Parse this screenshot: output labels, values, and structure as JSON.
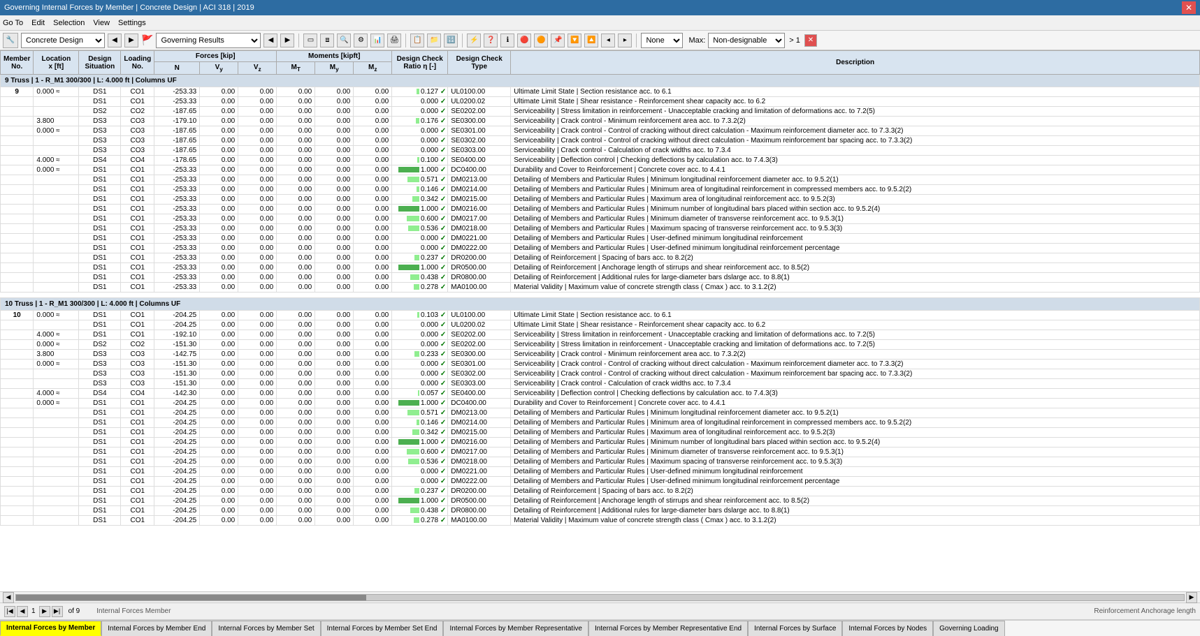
{
  "titleBar": {
    "title": "Governing Internal Forces by Member | Concrete Design | ACI 318 | 2019",
    "closeBtn": "✕"
  },
  "menuBar": {
    "items": [
      "Go To",
      "Edit",
      "Selection",
      "View",
      "Settings"
    ]
  },
  "toolbar": {
    "designSelect": "Concrete Design",
    "resultSelect": "Governing Results",
    "noneLabel": "None",
    "maxLabel": "Max:",
    "nonDesignableLabel": "Non-designable",
    "gt1Label": "> 1"
  },
  "tableHeaders": {
    "member": "Member\nNo.",
    "location": "Location\nx [ft]",
    "design": "Design\nSituation",
    "loading": "Loading\nNo.",
    "forcesLabel": "Forces [kip]",
    "N": "N",
    "Vy": "Vy",
    "Vz": "Vz",
    "momentsLabel": "Moments [kipft]",
    "MT": "MT",
    "My": "My",
    "Mz": "Mz",
    "ratioLabel": "Design Check\nRatio η [-]",
    "typeLabel": "Design Check\nType",
    "description": "Description"
  },
  "group1": {
    "header": "9    Truss | 1 - R_M1 300/300 | L: 4.000 ft | Columns UF",
    "rows": [
      {
        "loc": "0.000 ≈",
        "ds": "DS1",
        "load": "CO1",
        "N": "-253.33",
        "Vy": "0.00",
        "Vz": "0.00",
        "MT": "0.00",
        "My": "0.00",
        "Mz": "0.00",
        "ratio": "0.127",
        "check": "✓",
        "type": "UL0100.00",
        "desc": "Ultimate Limit State | Section resistance acc. to 6.1"
      },
      {
        "loc": "",
        "ds": "DS1",
        "load": "CO1",
        "N": "-253.33",
        "Vy": "0.00",
        "Vz": "0.00",
        "MT": "0.00",
        "My": "0.00",
        "Mz": "0.00",
        "ratio": "0.000",
        "check": "✓",
        "type": "UL0200.02",
        "desc": "Ultimate Limit State | Shear resistance - Reinforcement shear capacity acc. to 6.2"
      },
      {
        "loc": "",
        "ds": "DS2",
        "load": "CO2",
        "N": "-187.65",
        "Vy": "0.00",
        "Vz": "0.00",
        "MT": "0.00",
        "My": "0.00",
        "Mz": "0.00",
        "ratio": "0.000",
        "check": "✓",
        "type": "SE0202.00",
        "desc": "Serviceability | Stress limitation in reinforcement - Unacceptable cracking and limitation of deformations acc. to 7.2(5)"
      },
      {
        "loc": "3.800",
        "ds": "DS3",
        "load": "CO3",
        "N": "-179.10",
        "Vy": "0.00",
        "Vz": "0.00",
        "MT": "0.00",
        "My": "0.00",
        "Mz": "0.00",
        "ratio": "0.176",
        "check": "✓",
        "type": "SE0300.00",
        "desc": "Serviceability | Crack control - Minimum reinforcement area acc. to 7.3.2(2)"
      },
      {
        "loc": "0.000 ≈",
        "ds": "DS3",
        "load": "CO3",
        "N": "-187.65",
        "Vy": "0.00",
        "Vz": "0.00",
        "MT": "0.00",
        "My": "0.00",
        "Mz": "0.00",
        "ratio": "0.000",
        "check": "✓",
        "type": "SE0301.00",
        "desc": "Serviceability | Crack control - Control of cracking without direct calculation - Maximum reinforcement diameter acc. to 7.3.3(2)"
      },
      {
        "loc": "",
        "ds": "DS3",
        "load": "CO3",
        "N": "-187.65",
        "Vy": "0.00",
        "Vz": "0.00",
        "MT": "0.00",
        "My": "0.00",
        "Mz": "0.00",
        "ratio": "0.000",
        "check": "✓",
        "type": "SE0302.00",
        "desc": "Serviceability | Crack control - Control of cracking without direct calculation - Maximum reinforcement bar spacing acc. to 7.3.3(2)"
      },
      {
        "loc": "",
        "ds": "DS3",
        "load": "CO3",
        "N": "-187.65",
        "Vy": "0.00",
        "Vz": "0.00",
        "MT": "0.00",
        "My": "0.00",
        "Mz": "0.00",
        "ratio": "0.000",
        "check": "✓",
        "type": "SE0303.00",
        "desc": "Serviceability | Crack control - Calculation of crack widths acc. to 7.3.4"
      },
      {
        "loc": "4.000 ≈",
        "ds": "DS4",
        "load": "CO4",
        "N": "-178.65",
        "Vy": "0.00",
        "Vz": "0.00",
        "MT": "0.00",
        "My": "0.00",
        "Mz": "0.00",
        "ratio": "0.100",
        "check": "✓",
        "type": "SE0400.00",
        "desc": "Serviceability | Deflection control | Checking deflections by calculation acc. to 7.4.3(3)"
      },
      {
        "loc": "0.000 ≈",
        "ds": "DS1",
        "load": "CO1",
        "N": "-253.33",
        "Vy": "0.00",
        "Vz": "0.00",
        "MT": "0.00",
        "My": "0.00",
        "Mz": "0.00",
        "ratio": "1.000",
        "check": "✓",
        "type": "DC0400.00",
        "desc": "Durability and Cover to Reinforcement | Concrete cover acc. to 4.4.1"
      },
      {
        "loc": "",
        "ds": "DS1",
        "load": "CO1",
        "N": "-253.33",
        "Vy": "0.00",
        "Vz": "0.00",
        "MT": "0.00",
        "My": "0.00",
        "Mz": "0.00",
        "ratio": "0.571",
        "check": "✓",
        "type": "DM0213.00",
        "desc": "Detailing of Members and Particular Rules | Minimum longitudinal reinforcement diameter acc. to 9.5.2(1)"
      },
      {
        "loc": "",
        "ds": "DS1",
        "load": "CO1",
        "N": "-253.33",
        "Vy": "0.00",
        "Vz": "0.00",
        "MT": "0.00",
        "My": "0.00",
        "Mz": "0.00",
        "ratio": "0.146",
        "check": "✓",
        "type": "DM0214.00",
        "desc": "Detailing of Members and Particular Rules | Minimum area of longitudinal reinforcement in compressed members acc. to 9.5.2(2)"
      },
      {
        "loc": "",
        "ds": "DS1",
        "load": "CO1",
        "N": "-253.33",
        "Vy": "0.00",
        "Vz": "0.00",
        "MT": "0.00",
        "My": "0.00",
        "Mz": "0.00",
        "ratio": "0.342",
        "check": "✓",
        "type": "DM0215.00",
        "desc": "Detailing of Members and Particular Rules | Maximum area of longitudinal reinforcement acc. to 9.5.2(3)"
      },
      {
        "loc": "",
        "ds": "DS1",
        "load": "CO1",
        "N": "-253.33",
        "Vy": "0.00",
        "Vz": "0.00",
        "MT": "0.00",
        "My": "0.00",
        "Mz": "0.00",
        "ratio": "1.000",
        "check": "✓",
        "type": "DM0216.00",
        "desc": "Detailing of Members and Particular Rules | Minimum number of longitudinal bars placed within section acc. to 9.5.2(4)"
      },
      {
        "loc": "",
        "ds": "DS1",
        "load": "CO1",
        "N": "-253.33",
        "Vy": "0.00",
        "Vz": "0.00",
        "MT": "0.00",
        "My": "0.00",
        "Mz": "0.00",
        "ratio": "0.600",
        "check": "✓",
        "type": "DM0217.00",
        "desc": "Detailing of Members and Particular Rules | Minimum diameter of transverse reinforcement acc. to 9.5.3(1)"
      },
      {
        "loc": "",
        "ds": "DS1",
        "load": "CO1",
        "N": "-253.33",
        "Vy": "0.00",
        "Vz": "0.00",
        "MT": "0.00",
        "My": "0.00",
        "Mz": "0.00",
        "ratio": "0.536",
        "check": "✓",
        "type": "DM0218.00",
        "desc": "Detailing of Members and Particular Rules | Maximum spacing of transverse reinforcement acc. to 9.5.3(3)"
      },
      {
        "loc": "",
        "ds": "DS1",
        "load": "CO1",
        "N": "-253.33",
        "Vy": "0.00",
        "Vz": "0.00",
        "MT": "0.00",
        "My": "0.00",
        "Mz": "0.00",
        "ratio": "0.000",
        "check": "✓",
        "type": "DM0221.00",
        "desc": "Detailing of Members and Particular Rules | User-defined minimum longitudinal reinforcement"
      },
      {
        "loc": "",
        "ds": "DS1",
        "load": "CO1",
        "N": "-253.33",
        "Vy": "0.00",
        "Vz": "0.00",
        "MT": "0.00",
        "My": "0.00",
        "Mz": "0.00",
        "ratio": "0.000",
        "check": "✓",
        "type": "DM0222.00",
        "desc": "Detailing of Members and Particular Rules | User-defined minimum longitudinal reinforcement percentage"
      },
      {
        "loc": "",
        "ds": "DS1",
        "load": "CO1",
        "N": "-253.33",
        "Vy": "0.00",
        "Vz": "0.00",
        "MT": "0.00",
        "My": "0.00",
        "Mz": "0.00",
        "ratio": "0.237",
        "check": "✓",
        "type": "DR0200.00",
        "desc": "Detailing of Reinforcement | Spacing of bars acc. to 8.2(2)"
      },
      {
        "loc": "",
        "ds": "DS1",
        "load": "CO1",
        "N": "-253.33",
        "Vy": "0.00",
        "Vz": "0.00",
        "MT": "0.00",
        "My": "0.00",
        "Mz": "0.00",
        "ratio": "1.000",
        "check": "✓",
        "type": "DR0500.00",
        "desc": "Detailing of Reinforcement | Anchorage length of stirrups and shear reinforcement acc. to 8.5(2)"
      },
      {
        "loc": "",
        "ds": "DS1",
        "load": "CO1",
        "N": "-253.33",
        "Vy": "0.00",
        "Vz": "0.00",
        "MT": "0.00",
        "My": "0.00",
        "Mz": "0.00",
        "ratio": "0.438",
        "check": "✓",
        "type": "DR0800.00",
        "desc": "Detailing of Reinforcement | Additional rules for large-diameter bars dslarge acc. to 8.8(1)"
      },
      {
        "loc": "",
        "ds": "DS1",
        "load": "CO1",
        "N": "-253.33",
        "Vy": "0.00",
        "Vz": "0.00",
        "MT": "0.00",
        "My": "0.00",
        "Mz": "0.00",
        "ratio": "0.278",
        "check": "✓",
        "type": "MA0100.00",
        "desc": "Material Validity | Maximum value of concrete strength class ( Cmax ) acc. to 3.1.2(2)"
      }
    ]
  },
  "group2": {
    "header": "10    Truss | 1 - R_M1 300/300 | L: 4.000 ft | Columns UF",
    "rows": [
      {
        "loc": "0.000 ≈",
        "ds": "DS1",
        "load": "CO1",
        "N": "-204.25",
        "Vy": "0.00",
        "Vz": "0.00",
        "MT": "0.00",
        "My": "0.00",
        "Mz": "0.00",
        "ratio": "0.103",
        "check": "✓",
        "type": "UL0100.00",
        "desc": "Ultimate Limit State | Section resistance acc. to 6.1"
      },
      {
        "loc": "",
        "ds": "DS1",
        "load": "CO1",
        "N": "-204.25",
        "Vy": "0.00",
        "Vz": "0.00",
        "MT": "0.00",
        "My": "0.00",
        "Mz": "0.00",
        "ratio": "0.000",
        "check": "✓",
        "type": "UL0200.02",
        "desc": "Ultimate Limit State | Shear resistance - Reinforcement shear capacity acc. to 6.2"
      },
      {
        "loc": "4.000 ≈",
        "ds": "DS1",
        "load": "CO1",
        "N": "-192.10",
        "Vy": "0.00",
        "Vz": "0.00",
        "MT": "0.00",
        "My": "0.00",
        "Mz": "0.00",
        "ratio": "0.000",
        "check": "✓",
        "type": "SE0202.00",
        "desc": "Serviceability | Stress limitation in reinforcement - Unacceptable cracking and limitation of deformations acc. to 7.2(5)"
      },
      {
        "loc": "0.000 ≈",
        "ds": "DS2",
        "load": "CO2",
        "N": "-151.30",
        "Vy": "0.00",
        "Vz": "0.00",
        "MT": "0.00",
        "My": "0.00",
        "Mz": "0.00",
        "ratio": "0.000",
        "check": "✓",
        "type": "SE0202.00",
        "desc": "Serviceability | Stress limitation in reinforcement - Unacceptable cracking and limitation of deformations acc. to 7.2(5)"
      },
      {
        "loc": "3.800",
        "ds": "DS3",
        "load": "CO3",
        "N": "-142.75",
        "Vy": "0.00",
        "Vz": "0.00",
        "MT": "0.00",
        "My": "0.00",
        "Mz": "0.00",
        "ratio": "0.233",
        "check": "✓",
        "type": "SE0300.00",
        "desc": "Serviceability | Crack control - Minimum reinforcement area acc. to 7.3.2(2)"
      },
      {
        "loc": "0.000 ≈",
        "ds": "DS3",
        "load": "CO3",
        "N": "-151.30",
        "Vy": "0.00",
        "Vz": "0.00",
        "MT": "0.00",
        "My": "0.00",
        "Mz": "0.00",
        "ratio": "0.000",
        "check": "✓",
        "type": "SE0301.00",
        "desc": "Serviceability | Crack control - Control of cracking without direct calculation - Maximum reinforcement diameter acc. to 7.3.3(2)"
      },
      {
        "loc": "",
        "ds": "DS3",
        "load": "CO3",
        "N": "-151.30",
        "Vy": "0.00",
        "Vz": "0.00",
        "MT": "0.00",
        "My": "0.00",
        "Mz": "0.00",
        "ratio": "0.000",
        "check": "✓",
        "type": "SE0302.00",
        "desc": "Serviceability | Crack control - Control of cracking without direct calculation - Maximum reinforcement bar spacing acc. to 7.3.3(2)"
      },
      {
        "loc": "",
        "ds": "DS3",
        "load": "CO3",
        "N": "-151.30",
        "Vy": "0.00",
        "Vz": "0.00",
        "MT": "0.00",
        "My": "0.00",
        "Mz": "0.00",
        "ratio": "0.000",
        "check": "✓",
        "type": "SE0303.00",
        "desc": "Serviceability | Crack control - Calculation of crack widths acc. to 7.3.4"
      },
      {
        "loc": "4.000 ≈",
        "ds": "DS4",
        "load": "CO4",
        "N": "-142.30",
        "Vy": "0.00",
        "Vz": "0.00",
        "MT": "0.00",
        "My": "0.00",
        "Mz": "0.00",
        "ratio": "0.057",
        "check": "✓",
        "type": "SE0400.00",
        "desc": "Serviceability | Deflection control | Checking deflections by calculation acc. to 7.4.3(3)"
      },
      {
        "loc": "0.000 ≈",
        "ds": "DS1",
        "load": "CO1",
        "N": "-204.25",
        "Vy": "0.00",
        "Vz": "0.00",
        "MT": "0.00",
        "My": "0.00",
        "Mz": "0.00",
        "ratio": "1.000",
        "check": "✓",
        "type": "DC0400.00",
        "desc": "Durability and Cover to Reinforcement | Concrete cover acc. to 4.4.1"
      },
      {
        "loc": "",
        "ds": "DS1",
        "load": "CO1",
        "N": "-204.25",
        "Vy": "0.00",
        "Vz": "0.00",
        "MT": "0.00",
        "My": "0.00",
        "Mz": "0.00",
        "ratio": "0.571",
        "check": "✓",
        "type": "DM0213.00",
        "desc": "Detailing of Members and Particular Rules | Minimum longitudinal reinforcement diameter acc. to 9.5.2(1)"
      },
      {
        "loc": "",
        "ds": "DS1",
        "load": "CO1",
        "N": "-204.25",
        "Vy": "0.00",
        "Vz": "0.00",
        "MT": "0.00",
        "My": "0.00",
        "Mz": "0.00",
        "ratio": "0.146",
        "check": "✓",
        "type": "DM0214.00",
        "desc": "Detailing of Members and Particular Rules | Minimum area of longitudinal reinforcement in compressed members acc. to 9.5.2(2)"
      },
      {
        "loc": "",
        "ds": "DS1",
        "load": "CO1",
        "N": "-204.25",
        "Vy": "0.00",
        "Vz": "0.00",
        "MT": "0.00",
        "My": "0.00",
        "Mz": "0.00",
        "ratio": "0.342",
        "check": "✓",
        "type": "DM0215.00",
        "desc": "Detailing of Members and Particular Rules | Maximum area of longitudinal reinforcement acc. to 9.5.2(3)"
      },
      {
        "loc": "",
        "ds": "DS1",
        "load": "CO1",
        "N": "-204.25",
        "Vy": "0.00",
        "Vz": "0.00",
        "MT": "0.00",
        "My": "0.00",
        "Mz": "0.00",
        "ratio": "1.000",
        "check": "✓",
        "type": "DM0216.00",
        "desc": "Detailing of Members and Particular Rules | Minimum number of longitudinal bars placed within section acc. to 9.5.2(4)"
      },
      {
        "loc": "",
        "ds": "DS1",
        "load": "CO1",
        "N": "-204.25",
        "Vy": "0.00",
        "Vz": "0.00",
        "MT": "0.00",
        "My": "0.00",
        "Mz": "0.00",
        "ratio": "0.600",
        "check": "✓",
        "type": "DM0217.00",
        "desc": "Detailing of Members and Particular Rules | Minimum diameter of transverse reinforcement acc. to 9.5.3(1)"
      },
      {
        "loc": "",
        "ds": "DS1",
        "load": "CO1",
        "N": "-204.25",
        "Vy": "0.00",
        "Vz": "0.00",
        "MT": "0.00",
        "My": "0.00",
        "Mz": "0.00",
        "ratio": "0.536",
        "check": "✓",
        "type": "DM0218.00",
        "desc": "Detailing of Members and Particular Rules | Maximum spacing of transverse reinforcement acc. to 9.5.3(3)"
      },
      {
        "loc": "",
        "ds": "DS1",
        "load": "CO1",
        "N": "-204.25",
        "Vy": "0.00",
        "Vz": "0.00",
        "MT": "0.00",
        "My": "0.00",
        "Mz": "0.00",
        "ratio": "0.000",
        "check": "✓",
        "type": "DM0221.00",
        "desc": "Detailing of Members and Particular Rules | User-defined minimum longitudinal reinforcement"
      },
      {
        "loc": "",
        "ds": "DS1",
        "load": "CO1",
        "N": "-204.25",
        "Vy": "0.00",
        "Vz": "0.00",
        "MT": "0.00",
        "My": "0.00",
        "Mz": "0.00",
        "ratio": "0.000",
        "check": "✓",
        "type": "DM0222.00",
        "desc": "Detailing of Members and Particular Rules | User-defined minimum longitudinal reinforcement percentage"
      },
      {
        "loc": "",
        "ds": "DS1",
        "load": "CO1",
        "N": "-204.25",
        "Vy": "0.00",
        "Vz": "0.00",
        "MT": "0.00",
        "My": "0.00",
        "Mz": "0.00",
        "ratio": "0.237",
        "check": "✓",
        "type": "DR0200.00",
        "desc": "Detailing of Reinforcement | Spacing of bars acc. to 8.2(2)"
      },
      {
        "loc": "",
        "ds": "DS1",
        "load": "CO1",
        "N": "-204.25",
        "Vy": "0.00",
        "Vz": "0.00",
        "MT": "0.00",
        "My": "0.00",
        "Mz": "0.00",
        "ratio": "1.000",
        "check": "✓",
        "type": "DR0500.00",
        "desc": "Detailing of Reinforcement | Anchorage length of stirrups and shear reinforcement acc. to 8.5(2)"
      },
      {
        "loc": "",
        "ds": "DS1",
        "load": "CO1",
        "N": "-204.25",
        "Vy": "0.00",
        "Vz": "0.00",
        "MT": "0.00",
        "My": "0.00",
        "Mz": "0.00",
        "ratio": "0.438",
        "check": "✓",
        "type": "DR0800.00",
        "desc": "Detailing of Reinforcement | Additional rules for large-diameter bars dslarge acc. to 8.8(1)"
      },
      {
        "loc": "",
        "ds": "DS1",
        "load": "CO1",
        "N": "-204.25",
        "Vy": "0.00",
        "Vz": "0.00",
        "MT": "0.00",
        "My": "0.00",
        "Mz": "0.00",
        "ratio": "0.278",
        "check": "✓",
        "type": "MA0100.00",
        "desc": "Material Validity | Maximum value of concrete strength class ( Cmax ) acc. to 3.1.2(2)"
      }
    ]
  },
  "statusBar": {
    "page": "1",
    "of": "of 9"
  },
  "tabs": [
    {
      "label": "Internal Forces by Member",
      "active": true
    },
    {
      "label": "Internal Forces by Member End",
      "active": false
    },
    {
      "label": "Internal Forces by Member Set",
      "active": false
    },
    {
      "label": "Internal Forces by Member Set End",
      "active": false
    },
    {
      "label": "Internal Forces by Member Representative",
      "active": false
    },
    {
      "label": "Internal Forces by Member Representative End",
      "active": false
    },
    {
      "label": "Internal Forces by Surface",
      "active": false
    },
    {
      "label": "Internal Forces by Nodes",
      "active": false
    },
    {
      "label": "Governing Loading",
      "active": false
    }
  ]
}
